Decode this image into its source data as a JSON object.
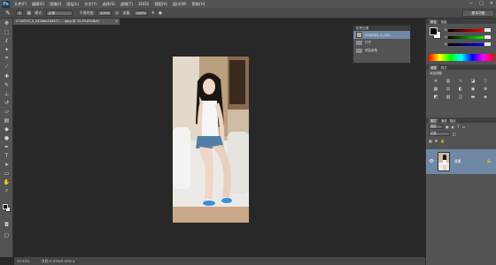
{
  "app": {
    "logo": "Ps",
    "menus": [
      "文件(F)",
      "编辑(E)",
      "图像(I)",
      "图层(L)",
      "文字(Y)",
      "选择(S)",
      "滤镜(T)",
      "3D(D)",
      "视图(V)",
      "窗口(W)",
      "帮助(H)"
    ],
    "window_controls": [
      "—",
      "□",
      "✕"
    ]
  },
  "options": {
    "brush_size": "3",
    "mode_label": "模式:",
    "mode_value": "正常",
    "opacity_label": "不透明度:",
    "opacity_value": "100%",
    "flow_label": "流量:",
    "flow_value": "100%",
    "workspace": "基本功能"
  },
  "document": {
    "tab_title": "2742252_5_h52dab7a0477 ... ajpg @ 33.3%(RGB/8)",
    "close": "×"
  },
  "history": {
    "title": "历史记录",
    "items": [
      "2742252_5_h52...",
      "打开",
      "修复画笔"
    ]
  },
  "color": {
    "tabs": [
      "颜色",
      "色板"
    ],
    "channels": [
      "R",
      "G",
      "B"
    ],
    "fg": "#000000",
    "bg": "#ffffff"
  },
  "adjust": {
    "tabs": [
      "调整",
      "样式"
    ],
    "title": "添加调整"
  },
  "layers": {
    "tabs": [
      "图层",
      "通道",
      "路径"
    ],
    "kind_value": "类型",
    "blend_value": "正常",
    "layer_name": "背景",
    "footer_icons": [
      "∞",
      "fx",
      "◐",
      "▣",
      "▭",
      "🗑"
    ]
  },
  "status": {
    "zoom": "33.33%",
    "doc_info": "文档:3.97M/3.97M"
  },
  "colors": {
    "menubar": "#535353",
    "canvas": "#282828",
    "selection": "#6f88a6"
  }
}
